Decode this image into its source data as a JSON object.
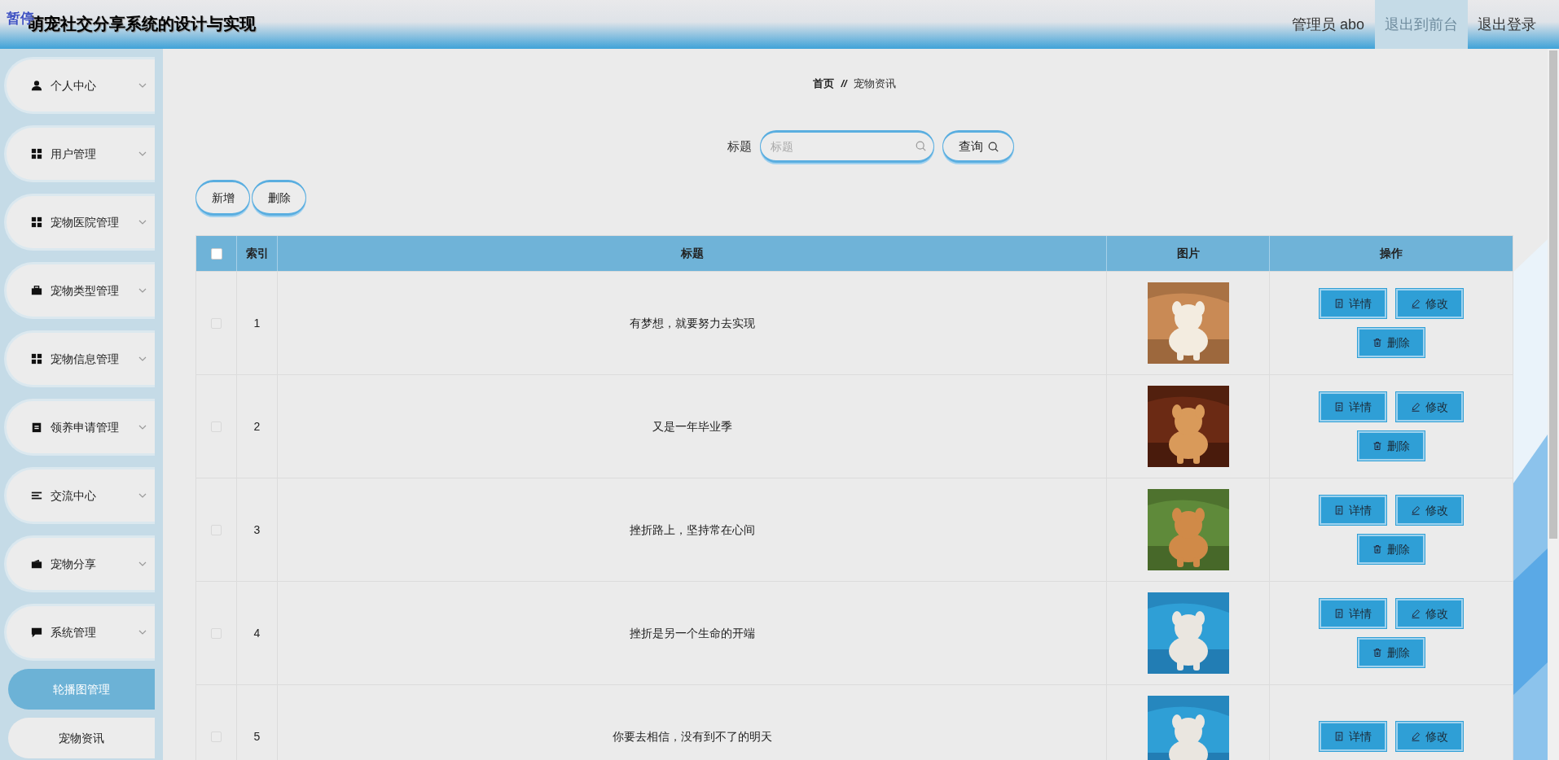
{
  "header": {
    "pause_label": "暂停",
    "title": "萌宠社交分享系统的设计与实现",
    "user": "管理员 abo",
    "links": [
      {
        "label": "退出到前台",
        "highlighted": true
      },
      {
        "label": "退出登录",
        "highlighted": false
      }
    ]
  },
  "sidebar": {
    "items": [
      {
        "label": "个人中心"
      },
      {
        "label": "用户管理"
      },
      {
        "label": "宠物医院管理"
      },
      {
        "label": "宠物类型管理"
      },
      {
        "label": "宠物信息管理"
      },
      {
        "label": "领养申请管理"
      },
      {
        "label": "交流中心"
      },
      {
        "label": "宠物分享"
      },
      {
        "label": "系统管理",
        "children": [
          {
            "label": "轮播图管理",
            "selected": true
          },
          {
            "label": "宠物资讯",
            "selected": false
          }
        ]
      }
    ]
  },
  "breadcrumb": {
    "home": "首页",
    "separator": "//",
    "current": "宠物资讯"
  },
  "search": {
    "label": "标题",
    "placeholder": "标题",
    "button": "查询"
  },
  "actions": [
    "新增",
    "删除"
  ],
  "table": {
    "select_all_checked": false,
    "columns": [
      "索引",
      "标题",
      "图片",
      "操作"
    ],
    "rows": [
      {
        "checked": false,
        "index": "1",
        "title": "有梦想，就要努力去实现",
        "buttons": [
          "详情",
          "修改",
          "删除"
        ]
      },
      {
        "checked": false,
        "index": "2",
        "title": "又是一年毕业季",
        "buttons": [
          "详情",
          "修改",
          "删除"
        ]
      },
      {
        "checked": false,
        "index": "3",
        "title": "挫折路上，坚持常在心间",
        "buttons": [
          "详情",
          "修改",
          "删除"
        ]
      },
      {
        "checked": false,
        "index": "4",
        "title": "挫折是另一个生命的开端",
        "buttons": [
          "详情",
          "修改",
          "删除"
        ]
      },
      {
        "checked": false,
        "index": "5",
        "title": "你要去相信，没有到不了的明天",
        "buttons": [
          "详情",
          "修改"
        ]
      }
    ]
  }
}
